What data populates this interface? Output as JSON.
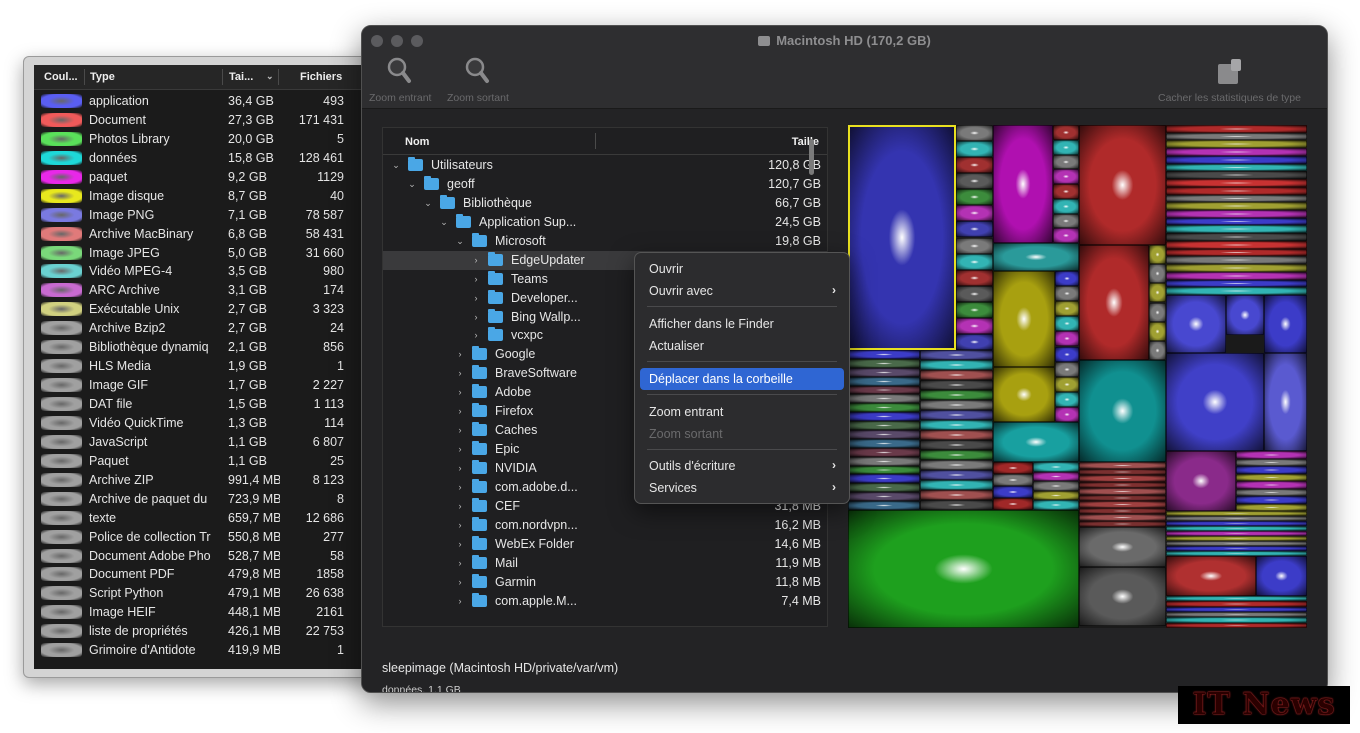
{
  "stats_panel": {
    "columns": {
      "color": "Coul...",
      "type": "Type",
      "size": "Tai...",
      "files": "Fichiers"
    },
    "rows": [
      {
        "color": "#5a5ef2",
        "type": "application",
        "size": "36,4 GB",
        "files": "493"
      },
      {
        "color": "#f05a5a",
        "type": "Document",
        "size": "27,3 GB",
        "files": "171 431"
      },
      {
        "color": "#5ae05a",
        "type": "Photos Library",
        "size": "20,0 GB",
        "files": "5"
      },
      {
        "color": "#1ed8d8",
        "type": "données",
        "size": "15,8 GB",
        "files": "128 461"
      },
      {
        "color": "#e828e8",
        "type": "paquet",
        "size": "9,2 GB",
        "files": "1129"
      },
      {
        "color": "#e8e81e",
        "type": "Image disque",
        "size": "8,7 GB",
        "files": "40"
      },
      {
        "color": "#7a7ae0",
        "type": "Image PNG",
        "size": "7,1 GB",
        "files": "78 587"
      },
      {
        "color": "#e07a7a",
        "type": "Archive MacBinary",
        "size": "6,8 GB",
        "files": "58 431"
      },
      {
        "color": "#7ad87a",
        "type": "Image JPEG",
        "size": "5,0 GB",
        "files": "31 660"
      },
      {
        "color": "#6ad0d0",
        "type": "Vidéo MPEG-4",
        "size": "3,5 GB",
        "files": "980"
      },
      {
        "color": "#c86ad0",
        "type": "ARC Archive",
        "size": "3,1 GB",
        "files": "174"
      },
      {
        "color": "#d0d080",
        "type": "Exécutable Unix",
        "size": "2,7 GB",
        "files": "3 323"
      },
      {
        "color": "#a0a0a0",
        "type": "Archive Bzip2",
        "size": "2,7 GB",
        "files": "24"
      },
      {
        "color": "#a0a0a0",
        "type": "Bibliothèque dynamiq",
        "size": "2,1 GB",
        "files": "856"
      },
      {
        "color": "#a0a0a0",
        "type": "HLS Media",
        "size": "1,9 GB",
        "files": "1"
      },
      {
        "color": "#a0a0a0",
        "type": "Image GIF",
        "size": "1,7 GB",
        "files": "2 227"
      },
      {
        "color": "#a0a0a0",
        "type": "DAT file",
        "size": "1,5 GB",
        "files": "1 113"
      },
      {
        "color": "#a0a0a0",
        "type": "Vidéo QuickTime",
        "size": "1,3 GB",
        "files": "114"
      },
      {
        "color": "#a0a0a0",
        "type": "JavaScript",
        "size": "1,1 GB",
        "files": "6 807"
      },
      {
        "color": "#a0a0a0",
        "type": "Paquet",
        "size": "1,1 GB",
        "files": "25"
      },
      {
        "color": "#a0a0a0",
        "type": "Archive ZIP",
        "size": "991,4 MB",
        "files": "8 123"
      },
      {
        "color": "#a0a0a0",
        "type": "Archive de paquet du",
        "size": "723,9 MB",
        "files": "8"
      },
      {
        "color": "#a0a0a0",
        "type": "texte",
        "size": "659,7 MB",
        "files": "12 686"
      },
      {
        "color": "#a0a0a0",
        "type": "Police de collection Tr",
        "size": "550,8 MB",
        "files": "277"
      },
      {
        "color": "#a0a0a0",
        "type": "Document Adobe Pho",
        "size": "528,7 MB",
        "files": "58"
      },
      {
        "color": "#a0a0a0",
        "type": "Document PDF",
        "size": "479,8 MB",
        "files": "1858"
      },
      {
        "color": "#a0a0a0",
        "type": "Script Python",
        "size": "479,1 MB",
        "files": "26 638"
      },
      {
        "color": "#a0a0a0",
        "type": "Image HEIF",
        "size": "448,1 MB",
        "files": "2161"
      },
      {
        "color": "#a0a0a0",
        "type": "liste de propriétés",
        "size": "426,1 MB",
        "files": "22 753"
      },
      {
        "color": "#a0a0a0",
        "type": "Grimoire d'Antidote",
        "size": "419,9 MB",
        "files": "1"
      }
    ]
  },
  "window": {
    "title": "Macintosh HD (170,2 GB)",
    "toolbar": {
      "zoom_in": "Zoom entrant",
      "zoom_out": "Zoom sortant",
      "hide_stats": "Cacher les statistiques de type"
    }
  },
  "outline": {
    "col_name": "Nom",
    "col_size": "Taille",
    "rows": [
      {
        "level": 0,
        "expanded": true,
        "name": "Utilisateurs",
        "size": "120,8 GB"
      },
      {
        "level": 1,
        "expanded": true,
        "name": "geoff",
        "size": "120,7 GB"
      },
      {
        "level": 2,
        "expanded": true,
        "name": "Bibliothèque",
        "size": "66,7 GB"
      },
      {
        "level": 3,
        "expanded": true,
        "name": "Application Sup...",
        "size": "24,5 GB"
      },
      {
        "level": 4,
        "expanded": true,
        "name": "Microsoft",
        "size": "19,8 GB"
      },
      {
        "level": 5,
        "expanded": false,
        "name": "EdgeUpdater",
        "size": "",
        "selected": true
      },
      {
        "level": 5,
        "expanded": false,
        "name": "Teams",
        "size": ""
      },
      {
        "level": 5,
        "expanded": false,
        "name": "Developer...",
        "size": ""
      },
      {
        "level": 5,
        "expanded": false,
        "name": "Bing Wallp...",
        "size": ""
      },
      {
        "level": 5,
        "expanded": false,
        "name": "vcxpc",
        "size": ""
      },
      {
        "level": 4,
        "expanded": false,
        "name": "Google",
        "size": ""
      },
      {
        "level": 4,
        "expanded": false,
        "name": "BraveSoftware",
        "size": ""
      },
      {
        "level": 4,
        "expanded": false,
        "name": "Adobe",
        "size": ""
      },
      {
        "level": 4,
        "expanded": false,
        "name": "Firefox",
        "size": ""
      },
      {
        "level": 4,
        "expanded": false,
        "name": "Caches",
        "size": ""
      },
      {
        "level": 4,
        "expanded": false,
        "name": "Epic",
        "size": ""
      },
      {
        "level": 4,
        "expanded": false,
        "name": "NVIDIA",
        "size": ""
      },
      {
        "level": 4,
        "expanded": false,
        "name": "com.adobe.d...",
        "size": ""
      },
      {
        "level": 4,
        "expanded": false,
        "name": "CEF",
        "size": "31,8 MB"
      },
      {
        "level": 4,
        "expanded": false,
        "name": "com.nordvpn...",
        "size": "16,2 MB"
      },
      {
        "level": 4,
        "expanded": false,
        "name": "WebEx Folder",
        "size": "14,6 MB"
      },
      {
        "level": 4,
        "expanded": false,
        "name": "Mail",
        "size": "11,9 MB"
      },
      {
        "level": 4,
        "expanded": false,
        "name": "Garmin",
        "size": "11,8 MB"
      },
      {
        "level": 4,
        "expanded": false,
        "name": "com.apple.M...",
        "size": "7,4 MB"
      }
    ]
  },
  "status": {
    "path": "sleepimage (Macintosh HD/private/var/vm)",
    "info": "données, 1,1 GB"
  },
  "context_menu": {
    "open": "Ouvrir",
    "open_with": "Ouvrir avec",
    "show_finder": "Afficher dans le Finder",
    "refresh": "Actualiser",
    "trash": "Déplacer dans la corbeille",
    "zoom_in": "Zoom entrant",
    "zoom_out": "Zoom sortant",
    "writing_tools": "Outils d'écriture",
    "services": "Services"
  },
  "watermark": "IT News"
}
